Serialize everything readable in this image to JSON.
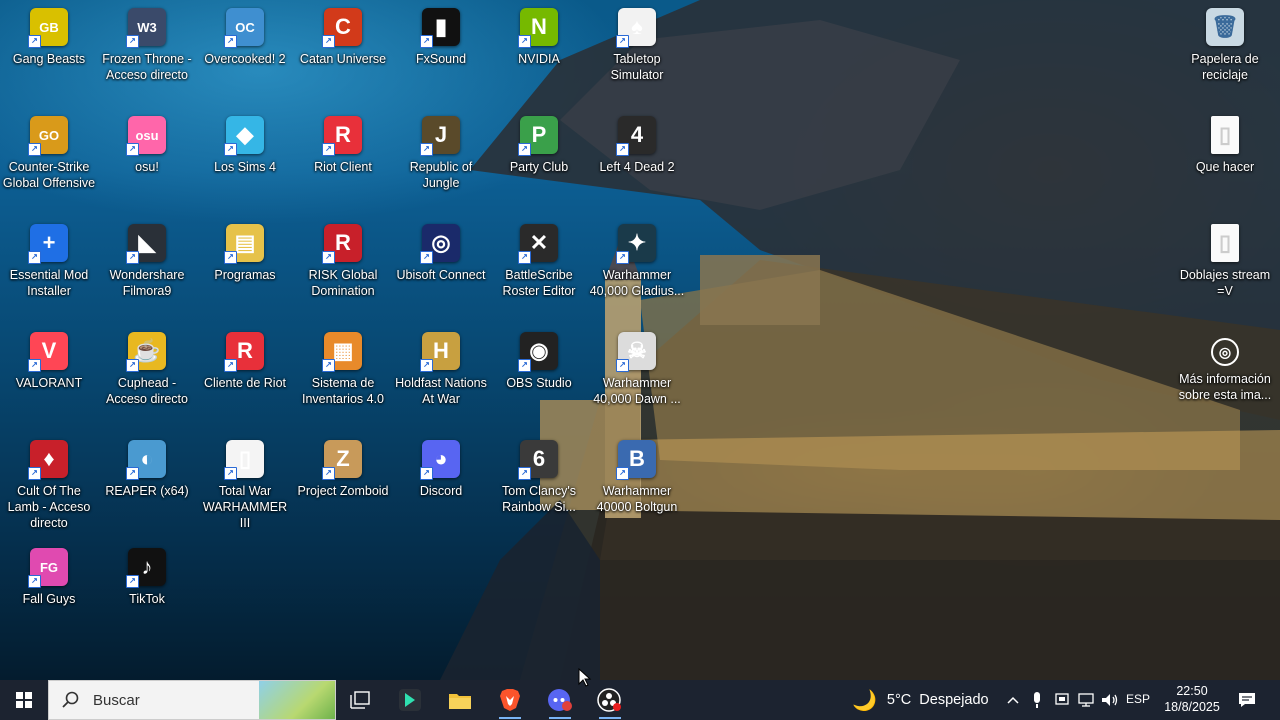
{
  "desktop": {
    "icons": [
      {
        "label": "Gang Beasts",
        "color": "#d9c000",
        "glyph": "GB"
      },
      {
        "label": "Frozen Throne - Acceso directo",
        "color": "#3a4a6a",
        "glyph": "W3"
      },
      {
        "label": "Overcooked! 2",
        "color": "#3f8fd0",
        "glyph": "OC"
      },
      {
        "label": "Catan Universe",
        "color": "#d23a1a",
        "glyph": "C"
      },
      {
        "label": "FxSound",
        "color": "#111111",
        "glyph": "▮"
      },
      {
        "label": "NVIDIA",
        "color": "#76b900",
        "glyph": "N"
      },
      {
        "label": "Tabletop Simulator",
        "color": "#f2f2f2",
        "glyph": "♠"
      },
      {
        "label": "Counter-Strike Global Offensive",
        "color": "#d99a1a",
        "glyph": "GO"
      },
      {
        "label": "osu!",
        "color": "#ff66aa",
        "glyph": "osu"
      },
      {
        "label": "Los Sims 4",
        "color": "#35b6e6",
        "glyph": "◆"
      },
      {
        "label": "Riot Client",
        "color": "#e8303a",
        "glyph": "R"
      },
      {
        "label": "Republic of Jungle",
        "color": "#5a4a2a",
        "glyph": "J"
      },
      {
        "label": "Party Club",
        "color": "#3aa04a",
        "glyph": "P"
      },
      {
        "label": "Left 4 Dead 2",
        "color": "#2a2a2a",
        "glyph": "4"
      },
      {
        "label": "Essential Mod Installer",
        "color": "#1f6fe5",
        "glyph": "+"
      },
      {
        "label": "Wondershare Filmora9",
        "color": "#2a3038",
        "glyph": "◣"
      },
      {
        "label": "Programas",
        "color": "#e6c24a",
        "glyph": "▤"
      },
      {
        "label": "RISK Global Domination",
        "color": "#c8202a",
        "glyph": "R"
      },
      {
        "label": "Ubisoft Connect",
        "color": "#1a2a6a",
        "glyph": "◎"
      },
      {
        "label": "BattleScribe Roster Editor",
        "color": "#2a2a2a",
        "glyph": "✕"
      },
      {
        "label": "Warhammer 40,000 Gladius...",
        "color": "#1a3a4a",
        "glyph": "✦"
      },
      {
        "label": "VALORANT",
        "color": "#ff4655",
        "glyph": "V"
      },
      {
        "label": "Cuphead - Acceso directo",
        "color": "#e8b820",
        "glyph": "☕"
      },
      {
        "label": "Cliente de Riot",
        "color": "#e8303a",
        "glyph": "R"
      },
      {
        "label": "Sistema de Inventarios 4.0",
        "color": "#e88a2a",
        "glyph": "▦"
      },
      {
        "label": "Holdfast Nations At War",
        "color": "#c8a040",
        "glyph": "H"
      },
      {
        "label": "OBS Studio",
        "color": "#222222",
        "glyph": "◉"
      },
      {
        "label": "Warhammer 40,000 Dawn ...",
        "color": "#dcdcdc",
        "glyph": "☠"
      },
      {
        "label": "Cult Of The Lamb - Acceso directo",
        "color": "#c8202a",
        "glyph": "♦"
      },
      {
        "label": "REAPER (x64)",
        "color": "#4a9ad0",
        "glyph": "◐"
      },
      {
        "label": "Total War WARHAMMER III",
        "color": "#f4f4f4",
        "glyph": "▯"
      },
      {
        "label": "Project Zomboid",
        "color": "#c89a5a",
        "glyph": "Z"
      },
      {
        "label": "Discord",
        "color": "#5865f2",
        "glyph": "◕"
      },
      {
        "label": "Tom Clancy's Rainbow Si...",
        "color": "#3a3a3a",
        "glyph": "6"
      },
      {
        "label": "Warhammer 40000 Boltgun",
        "color": "#3a6ab0",
        "glyph": "B"
      },
      {
        "label": "Fall Guys",
        "color": "#e04ab0",
        "glyph": "FG"
      },
      {
        "label": "TikTok",
        "color": "#111111",
        "glyph": "♪"
      }
    ],
    "right_icons": [
      {
        "label": "Papelera de reciclaje",
        "glyph": "🗑"
      },
      {
        "label": "Que hacer",
        "glyph": "▯"
      },
      {
        "label": "Doblajes stream =V",
        "glyph": "▯"
      },
      {
        "label": "Más información sobre esta ima...",
        "glyph": "◎"
      }
    ]
  },
  "taskbar": {
    "search_placeholder": "Buscar",
    "weather": "5°C  Despejado",
    "language": "ESP",
    "time": "22:50",
    "date": "18/8/2025"
  }
}
